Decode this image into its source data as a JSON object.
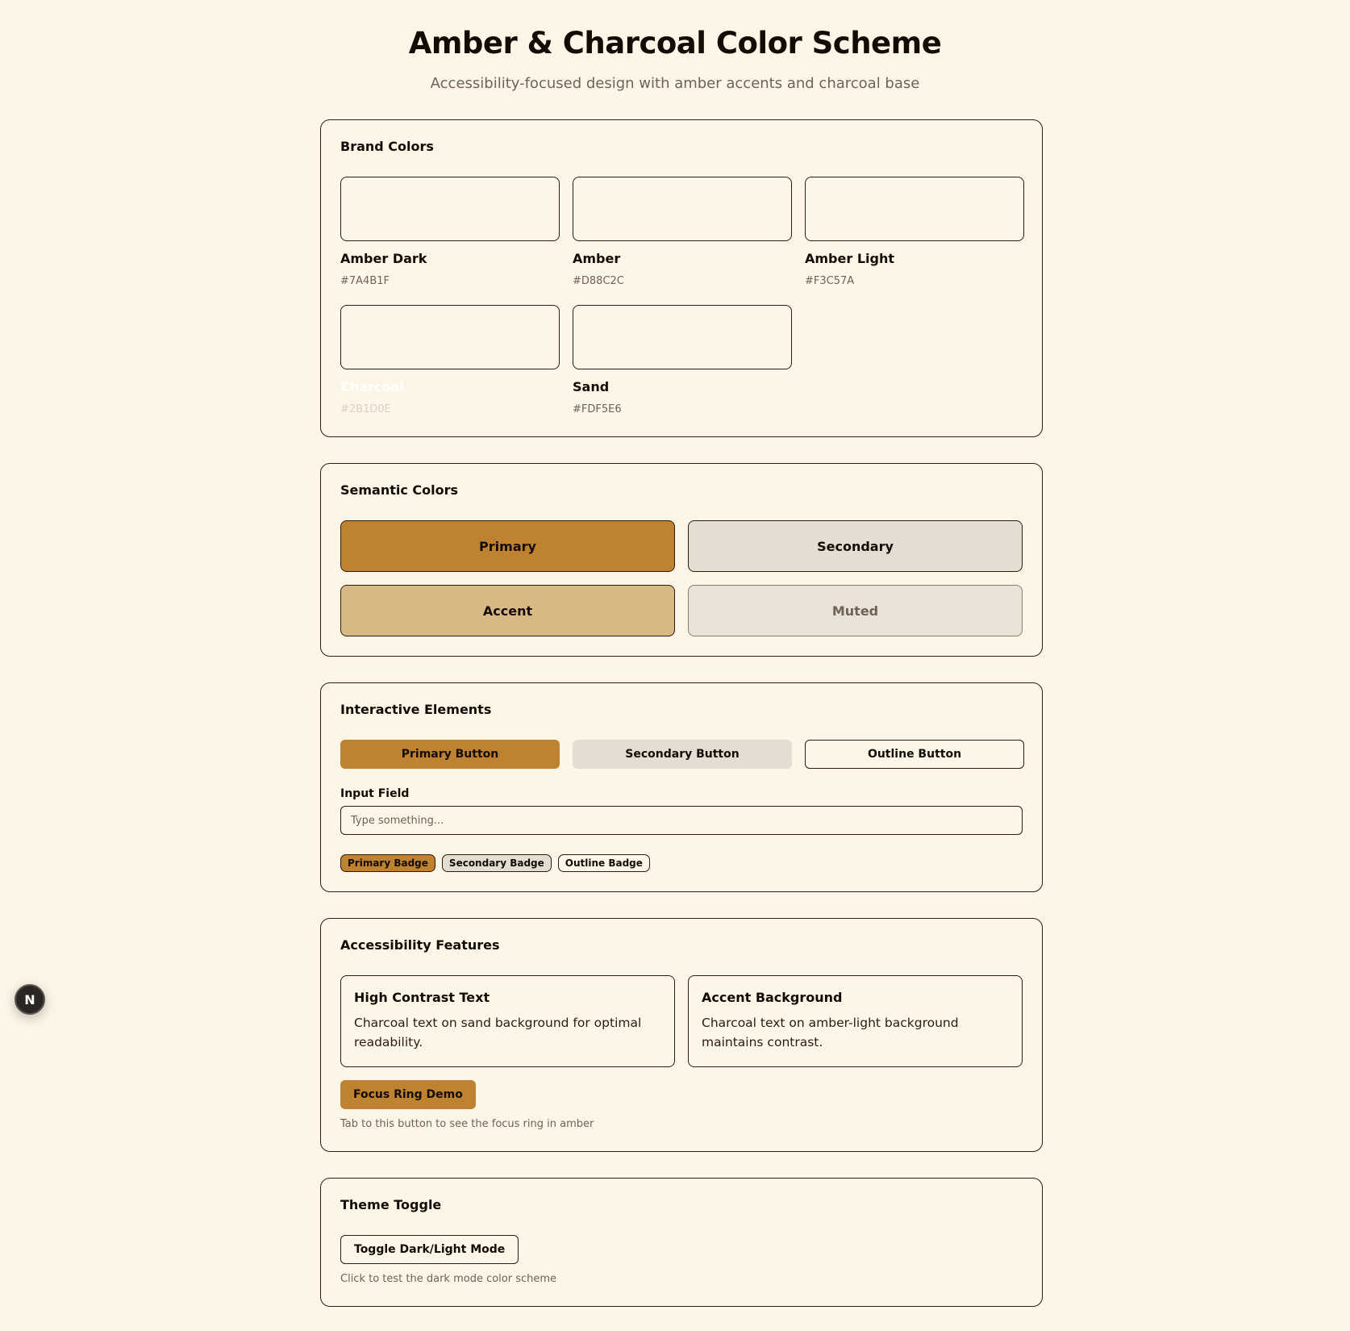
{
  "header": {
    "title": "Amber & Charcoal Color Scheme",
    "subtitle": "Accessibility-focused design with amber accents and charcoal base"
  },
  "brand": {
    "title": "Brand Colors",
    "swatches": [
      {
        "name": "Amber Dark",
        "hex": "#7A4B1F"
      },
      {
        "name": "Amber",
        "hex": "#D88C2C"
      },
      {
        "name": "Amber Light",
        "hex": "#F3C57A"
      },
      {
        "name": "Charcoal",
        "hex": "#2B1D0E"
      },
      {
        "name": "Sand",
        "hex": "#FDF5E6"
      }
    ]
  },
  "semantic": {
    "title": "Semantic Colors",
    "primary": "Primary",
    "secondary": "Secondary",
    "accent": "Accent",
    "muted": "Muted"
  },
  "interactive": {
    "title": "Interactive Elements",
    "primary_button": "Primary Button",
    "secondary_button": "Secondary Button",
    "outline_button": "Outline Button",
    "input_label": "Input Field",
    "input_placeholder": "Type something...",
    "input_value": "",
    "badges": {
      "primary": "Primary Badge",
      "secondary": "Secondary Badge",
      "outline": "Outline Badge"
    }
  },
  "accessibility": {
    "title": "Accessibility Features",
    "features": [
      {
        "title": "High Contrast Text",
        "text": "Charcoal text on sand background for optimal readability."
      },
      {
        "title": "Accent Background",
        "text": "Charcoal text on amber-light background maintains contrast."
      }
    ],
    "focus_button": "Focus Ring Demo",
    "focus_hint": "Tab to this button to see the focus ring in amber"
  },
  "theme": {
    "title": "Theme Toggle",
    "toggle_button": "Toggle Dark/Light Mode",
    "hint": "Click to test the dark mode color scheme"
  },
  "floating": {
    "label": "N",
    "icon": "nextjs-logo-icon"
  },
  "colors": {
    "background": "#FDF5E6",
    "text": "#2B1D0E",
    "primary": "#BF8231",
    "secondary": "#E4DDD2",
    "accent": "#D8B985",
    "muted": "#EAE2D8"
  }
}
